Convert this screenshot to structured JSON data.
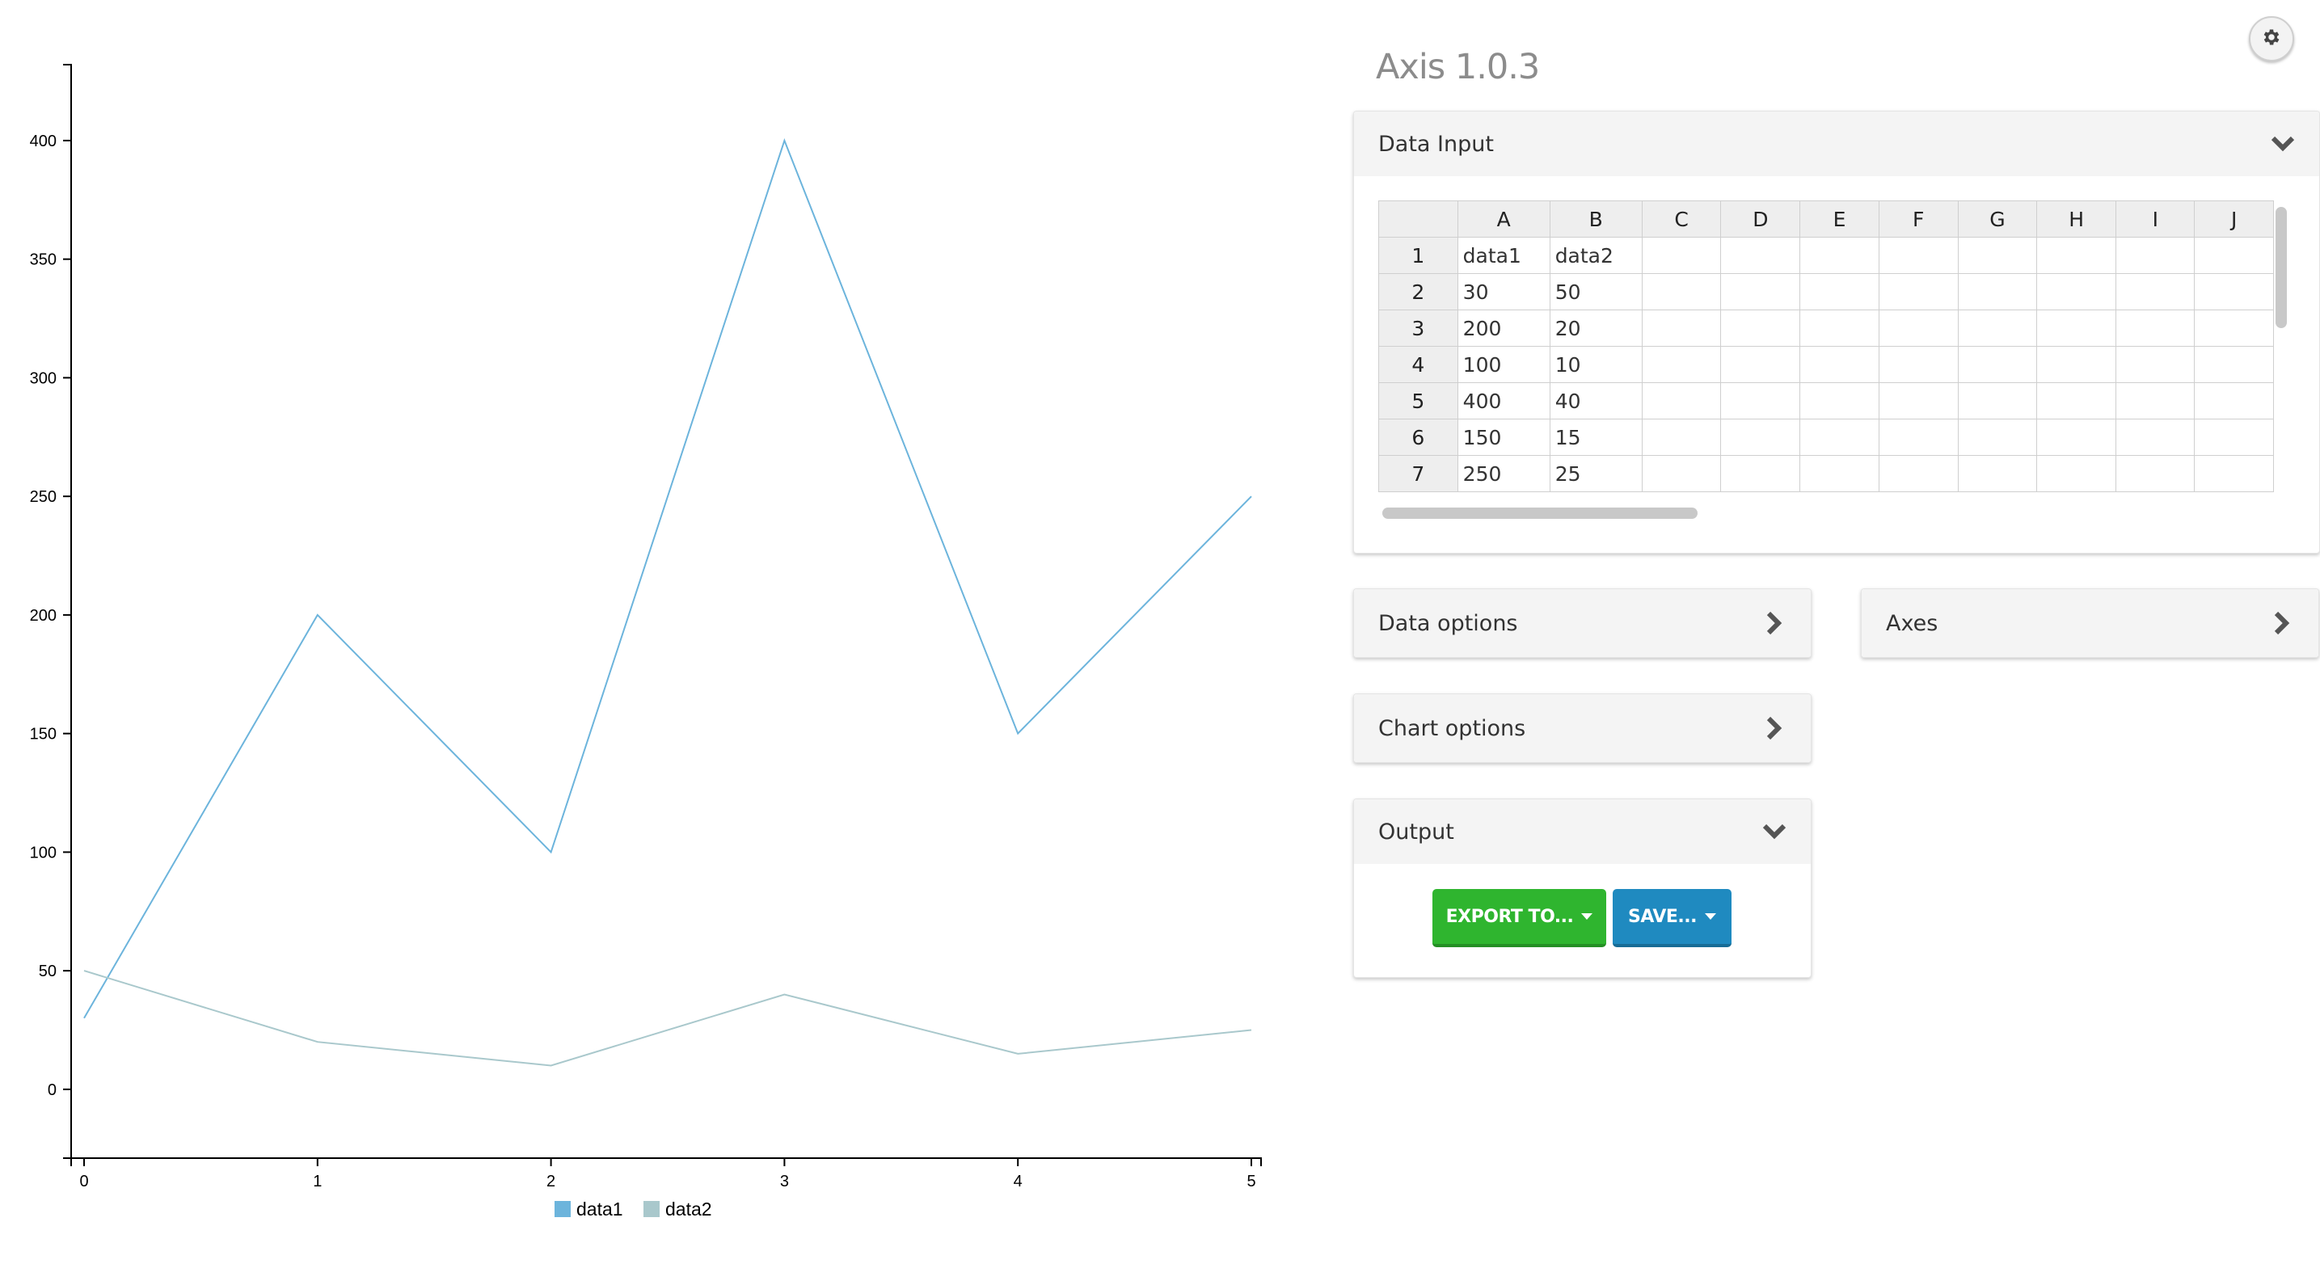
{
  "app": {
    "title": "Axis 1.0.3"
  },
  "panels": {
    "data_input": {
      "title": "Data Input"
    },
    "data_options": {
      "title": "Data options"
    },
    "axes": {
      "title": "Axes"
    },
    "chart_options": {
      "title": "Chart options"
    },
    "output": {
      "title": "Output"
    }
  },
  "spreadsheet": {
    "columns": [
      "A",
      "B",
      "C",
      "D",
      "E",
      "F",
      "G",
      "H",
      "I",
      "J"
    ],
    "rows": [
      {
        "num": "1",
        "cells": [
          "data1",
          "data2",
          "",
          "",
          "",
          "",
          "",
          "",
          "",
          ""
        ]
      },
      {
        "num": "2",
        "cells": [
          "30",
          "50",
          "",
          "",
          "",
          "",
          "",
          "",
          "",
          ""
        ]
      },
      {
        "num": "3",
        "cells": [
          "200",
          "20",
          "",
          "",
          "",
          "",
          "",
          "",
          "",
          ""
        ]
      },
      {
        "num": "4",
        "cells": [
          "100",
          "10",
          "",
          "",
          "",
          "",
          "",
          "",
          "",
          ""
        ]
      },
      {
        "num": "5",
        "cells": [
          "400",
          "40",
          "",
          "",
          "",
          "",
          "",
          "",
          "",
          ""
        ]
      },
      {
        "num": "6",
        "cells": [
          "150",
          "15",
          "",
          "",
          "",
          "",
          "",
          "",
          "",
          ""
        ]
      },
      {
        "num": "7",
        "cells": [
          "250",
          "25",
          "",
          "",
          "",
          "",
          "",
          "",
          "",
          ""
        ]
      }
    ]
  },
  "output": {
    "export_label": "EXPORT TO...",
    "save_label": "SAVE..."
  },
  "icons": {
    "settings": "gear-icon",
    "expanded": "chevron-down-icon",
    "collapsed": "chevron-right-icon"
  },
  "colors": {
    "data1": "#6cb4dc",
    "data2": "#a9c8cc",
    "export_button": "#2fb52f",
    "save_button": "#1f8ac0"
  },
  "chart_data": {
    "type": "line",
    "x": [
      0,
      1,
      2,
      3,
      4,
      5
    ],
    "x_ticks": [
      0,
      1,
      2,
      3,
      4,
      5
    ],
    "y_ticks": [
      0,
      50,
      100,
      150,
      200,
      250,
      300,
      350,
      400
    ],
    "xlim": [
      0,
      5
    ],
    "ylim": [
      -29,
      432
    ],
    "series": [
      {
        "name": "data1",
        "values": [
          30,
          200,
          100,
          400,
          150,
          250
        ]
      },
      {
        "name": "data2",
        "values": [
          50,
          20,
          10,
          40,
          15,
          25
        ]
      }
    ],
    "legend": "bottom-center",
    "grid": false
  }
}
